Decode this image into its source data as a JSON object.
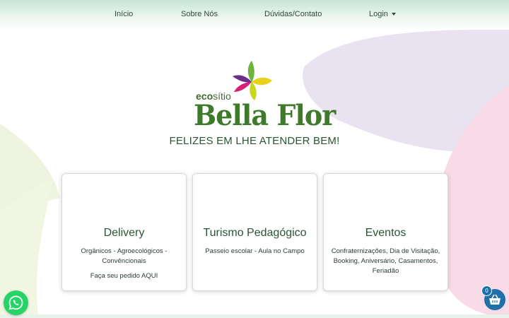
{
  "nav": {
    "items": [
      {
        "label": "Início"
      },
      {
        "label": "Sobre Nós"
      },
      {
        "label": "Dúvidas/Contato"
      },
      {
        "label": "Login"
      }
    ]
  },
  "logo": {
    "eco": "eco",
    "sitio": "sítio",
    "name": "Bella Flor"
  },
  "tagline": "FELIZES EM LHE ATENDER BEM!",
  "cards": [
    {
      "title": "Delivery",
      "text": "Orgânicos - Agroecológicos - Convêncionais",
      "link": "Faça seu pedido AQUI"
    },
    {
      "title": "Turismo Pedagógico",
      "text": "Passeio escolar - Aula no Campo"
    },
    {
      "title": "Eventos",
      "text": "Confraternizações, Dia de Visitação, Booking, Aniversário, Casamentos, Feriadão"
    }
  ],
  "cart": {
    "count": "0"
  },
  "icons": {
    "whatsapp": "whatsapp-icon",
    "cart": "basket-icon",
    "dropdown": "chevron-down-icon"
  },
  "colors": {
    "brand_green": "#3d7a2a",
    "heading_green": "#2a5532",
    "whatsapp": "#25d366",
    "cart_blue": "#1f6fa8"
  }
}
